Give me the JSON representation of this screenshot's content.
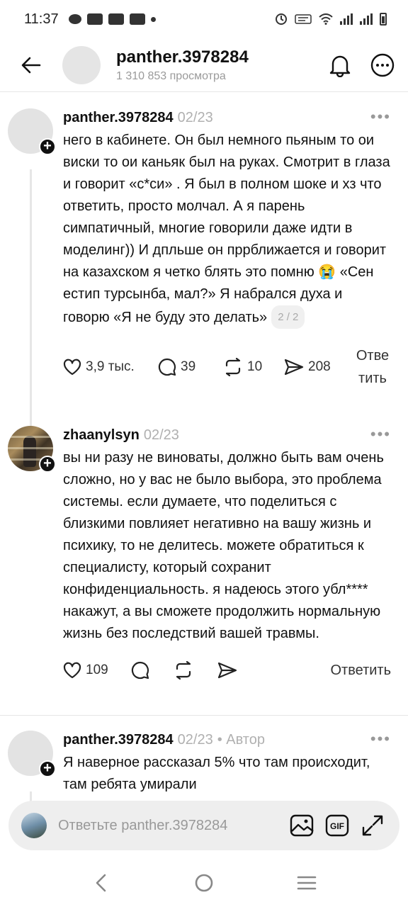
{
  "status_bar": {
    "time": "11:37"
  },
  "header": {
    "title": "panther.3978284",
    "views": "1 310 853 просмотра"
  },
  "comments": [
    {
      "author": "panther.3978284",
      "date": "02/23",
      "tag": "",
      "text": "него в кабинете. Он был немного пьяным то ои виски то ои каньяк был на руках. Смотрит в глаза и говорит «с*си» . Я был в полном шоке и хз что ответить, просто молчал. А я парень симпатичный, многие говорили даже идти в моделинг)) И дпльше он пррближается и говорит на казахском я четко блять это помню 😭 «Сен естип турсынба, мал?» Я набрался духа и говорю «Я не буду это делать»",
      "page": "2 / 2",
      "likes": "3,9 тыс.",
      "replies": "39",
      "reposts": "10",
      "shares": "208",
      "reply_label": "Ответить"
    },
    {
      "author": "zhaanylsyn",
      "date": "02/23",
      "tag": "",
      "text": "вы ни разу не виноваты, должно быть вам очень сложно, но у вас не было выбора, это проблема системы. если думаете, что поделиться с близкими повлияет негативно на вашу жизнь и психику, то не делитесь. можете обратиться к специалисту, который сохранит конфиденциальность. я надеюсь этого убл**** накажут, а вы сможете продолжить нормальную жизнь без последствий вашей травмы.",
      "likes": "109",
      "reply_label": "Ответить"
    },
    {
      "author": "panther.3978284",
      "date": "02/23",
      "tag": "• Автор",
      "text": "Я наверное рассказал 5% что там происходит, там ребята умирали"
    }
  ],
  "reply_bar": {
    "placeholder": "Ответьте panther.3978284"
  },
  "icons": {
    "back": "arrow-left-icon",
    "bell": "bell-icon",
    "more": "more-horizontal-icon",
    "like": "heart-icon",
    "comment": "speech-bubble-icon",
    "repost": "repost-icon",
    "share": "send-icon",
    "image": "image-icon",
    "gif": "gif-icon",
    "expand": "expand-icon"
  }
}
